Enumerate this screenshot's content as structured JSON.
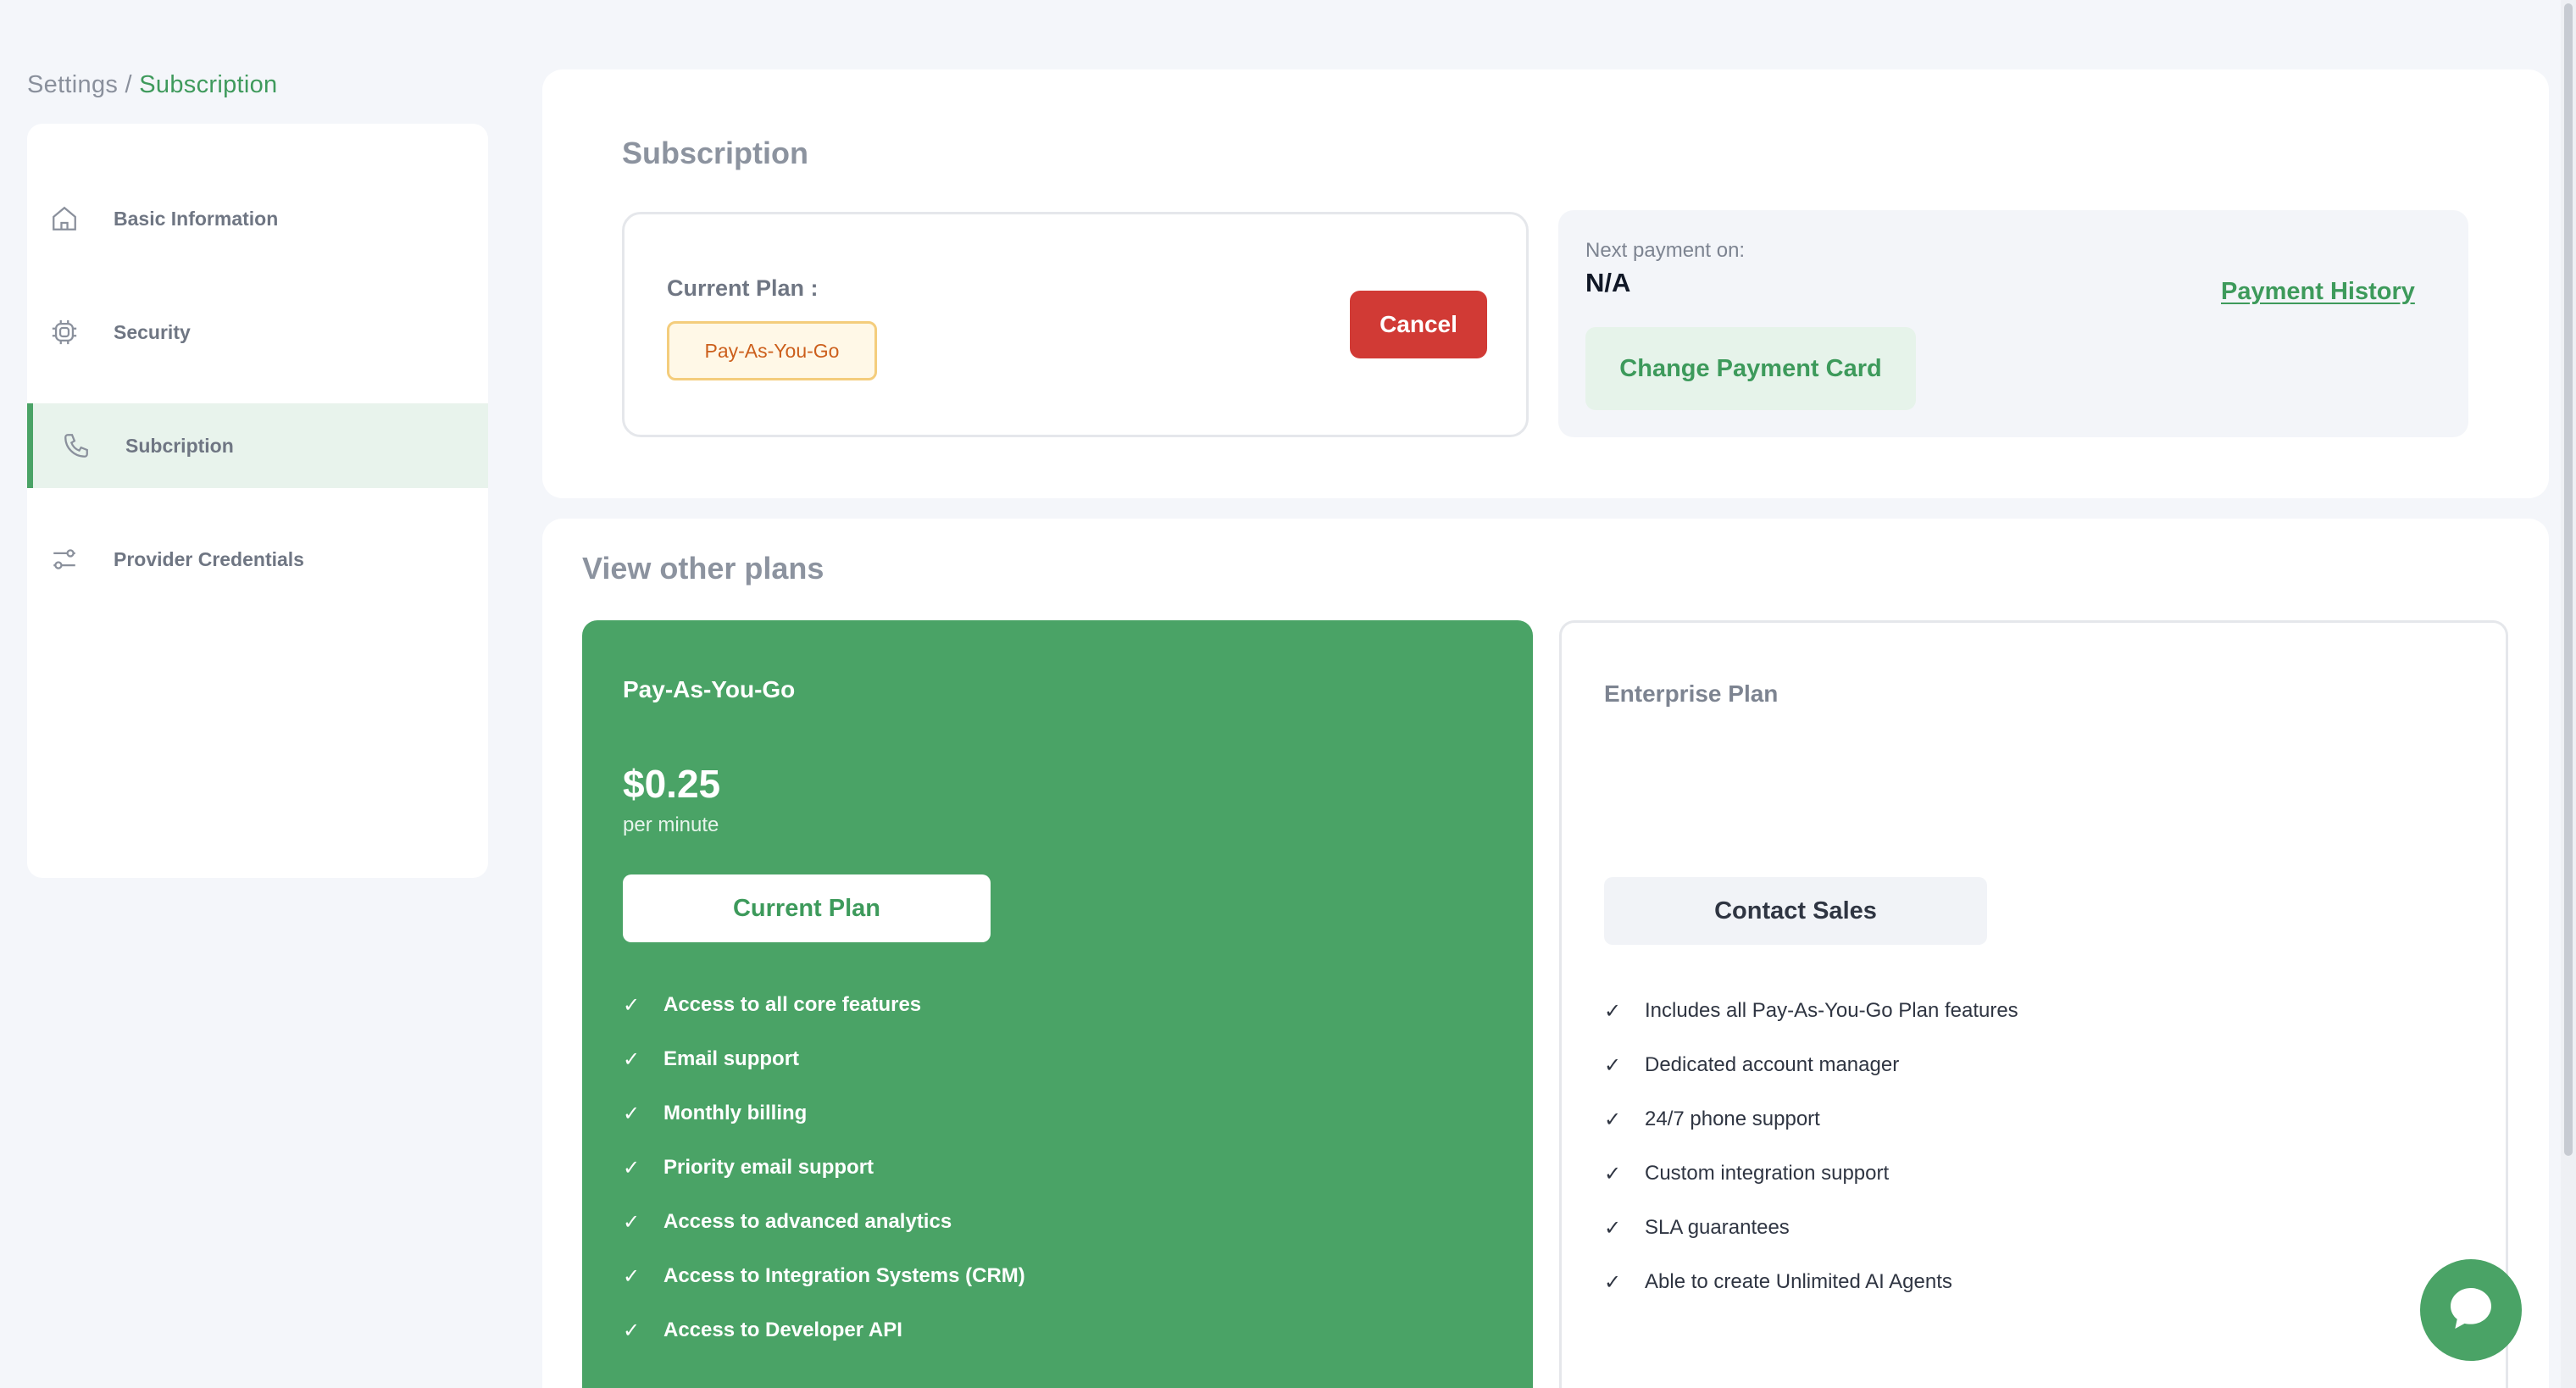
{
  "breadcrumb": {
    "root": "Settings",
    "separator": " / ",
    "current": "Subscription"
  },
  "sidebar": {
    "items": [
      {
        "label": "Basic Information",
        "icon": "home-icon"
      },
      {
        "label": "Security",
        "icon": "chip-icon"
      },
      {
        "label": "Subcription",
        "icon": "phone-icon",
        "active": true
      },
      {
        "label": "Provider Credentials",
        "icon": "sliders-icon"
      }
    ]
  },
  "subscription": {
    "title": "Subscription",
    "current_plan_label": "Current Plan :",
    "current_plan_badge": "Pay-As-You-Go",
    "cancel_label": "Cancel",
    "next_payment_label": "Next payment on:",
    "next_payment_value": "N/A",
    "change_card_label": "Change Payment Card",
    "payment_history_label": "Payment History"
  },
  "plans": {
    "title": "View other plans",
    "payg": {
      "name": "Pay-As-You-Go",
      "price": "$0.25",
      "unit": "per minute",
      "button": "Current Plan",
      "features": [
        "Access to all core features",
        "Email support",
        "Monthly billing",
        "Priority email support",
        "Access to advanced analytics",
        "Access to Integration Systems (CRM)",
        "Access to Developer API"
      ]
    },
    "enterprise": {
      "name": "Enterprise Plan",
      "button": "Contact Sales",
      "features": [
        "Includes all Pay-As-You-Go Plan features",
        "Dedicated account manager",
        "24/7 phone support",
        "Custom integration support",
        "SLA guarantees",
        "Able to create Unlimited AI Agents"
      ]
    }
  },
  "colors": {
    "accent": "#4aa366",
    "danger": "#d13a35",
    "badge_text": "#cc5f1c"
  }
}
